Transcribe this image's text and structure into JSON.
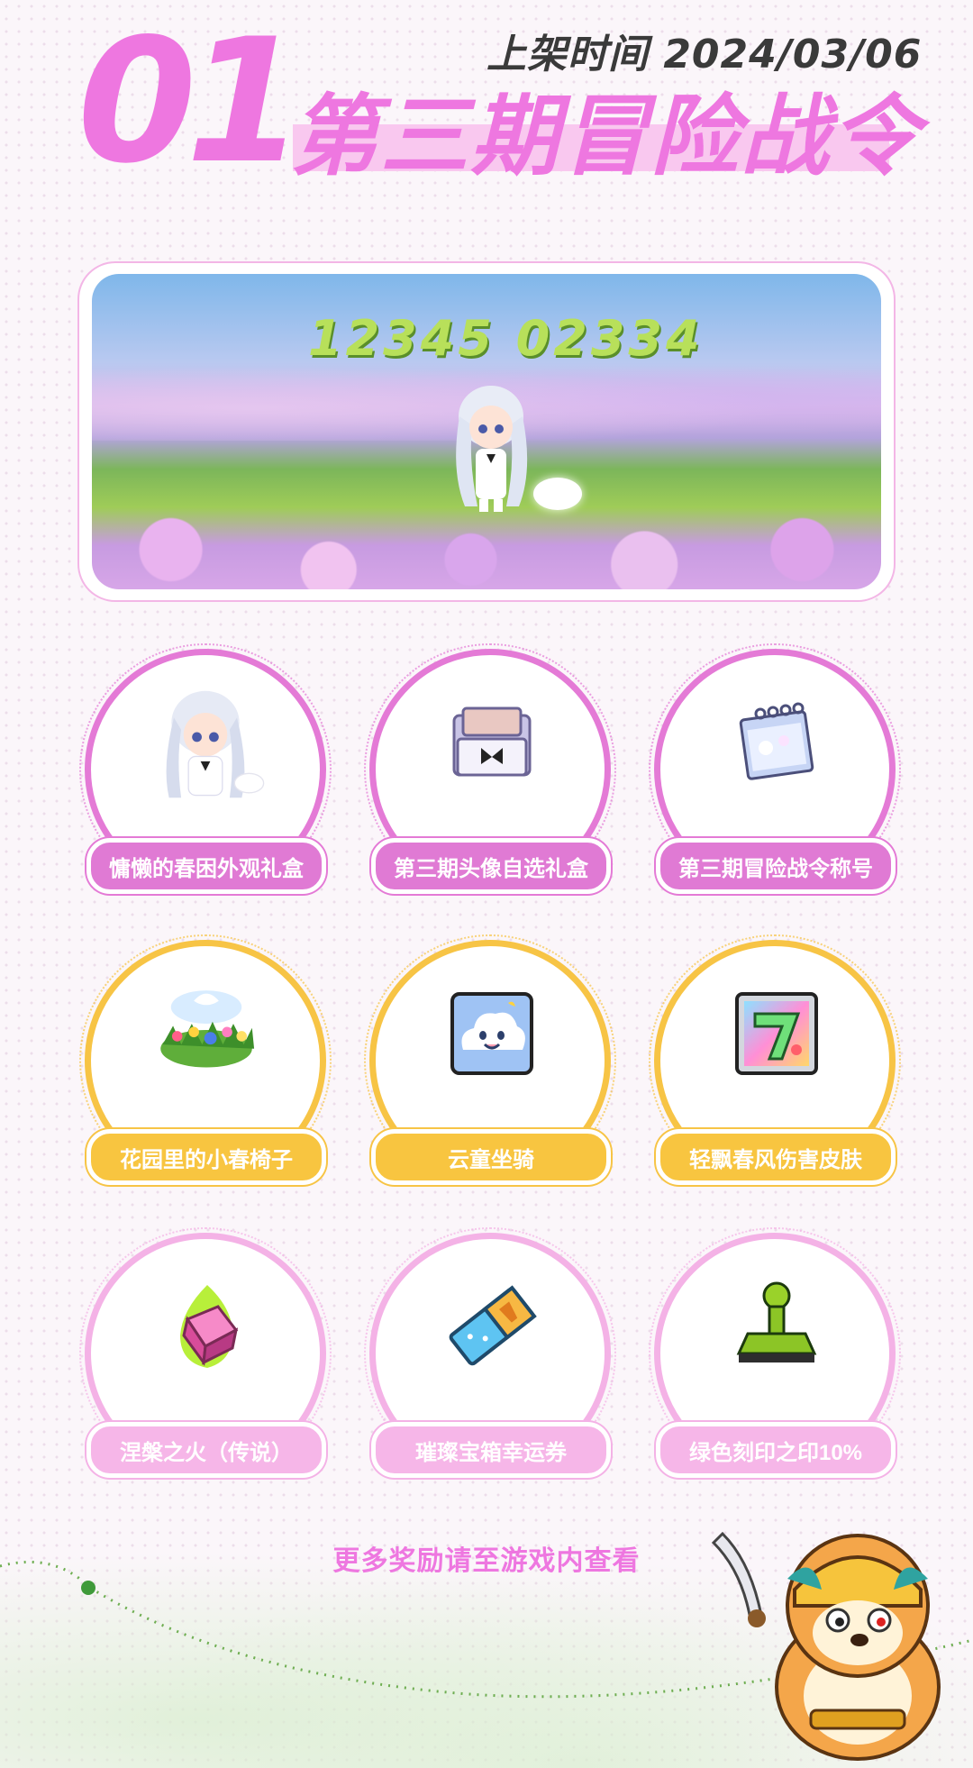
{
  "header": {
    "number": "01",
    "date": "上架时间 2024/03/06",
    "title": "第三期冒险战令"
  },
  "banner": {
    "digits": "12345 02334"
  },
  "rewards": [
    {
      "label": "慵懒的春困外观礼盒",
      "icon": "character-outfit-icon",
      "tier": "pink"
    },
    {
      "label": "第三期头像自选礼盒",
      "icon": "avatar-box-icon",
      "tier": "pink"
    },
    {
      "label": "第三期冒险战令称号",
      "icon": "calendar-title-icon",
      "tier": "pink"
    },
    {
      "label": "花园里的小春椅子",
      "icon": "flower-chair-icon",
      "tier": "gold"
    },
    {
      "label": "云童坐骑",
      "icon": "cloud-mount-icon",
      "tier": "gold"
    },
    {
      "label": "轻飘春风伤害皮肤",
      "icon": "damage-skin-icon",
      "tier": "gold"
    },
    {
      "label": "涅槃之火（传说）",
      "icon": "nirvana-flame-icon",
      "tier": "light-pink"
    },
    {
      "label": "璀璨宝箱幸运券",
      "icon": "lucky-ticket-icon",
      "tier": "light-pink"
    },
    {
      "label": "绿色刻印之印10%",
      "icon": "green-stamp-icon",
      "tier": "light-pink"
    }
  ],
  "footer": {
    "more_text": "更多奖励请至游戏内查看"
  },
  "colors": {
    "pink": "#e07ad4",
    "gold": "#f8c540",
    "light_pink": "#f6b6e8",
    "title": "#ee77e0"
  }
}
